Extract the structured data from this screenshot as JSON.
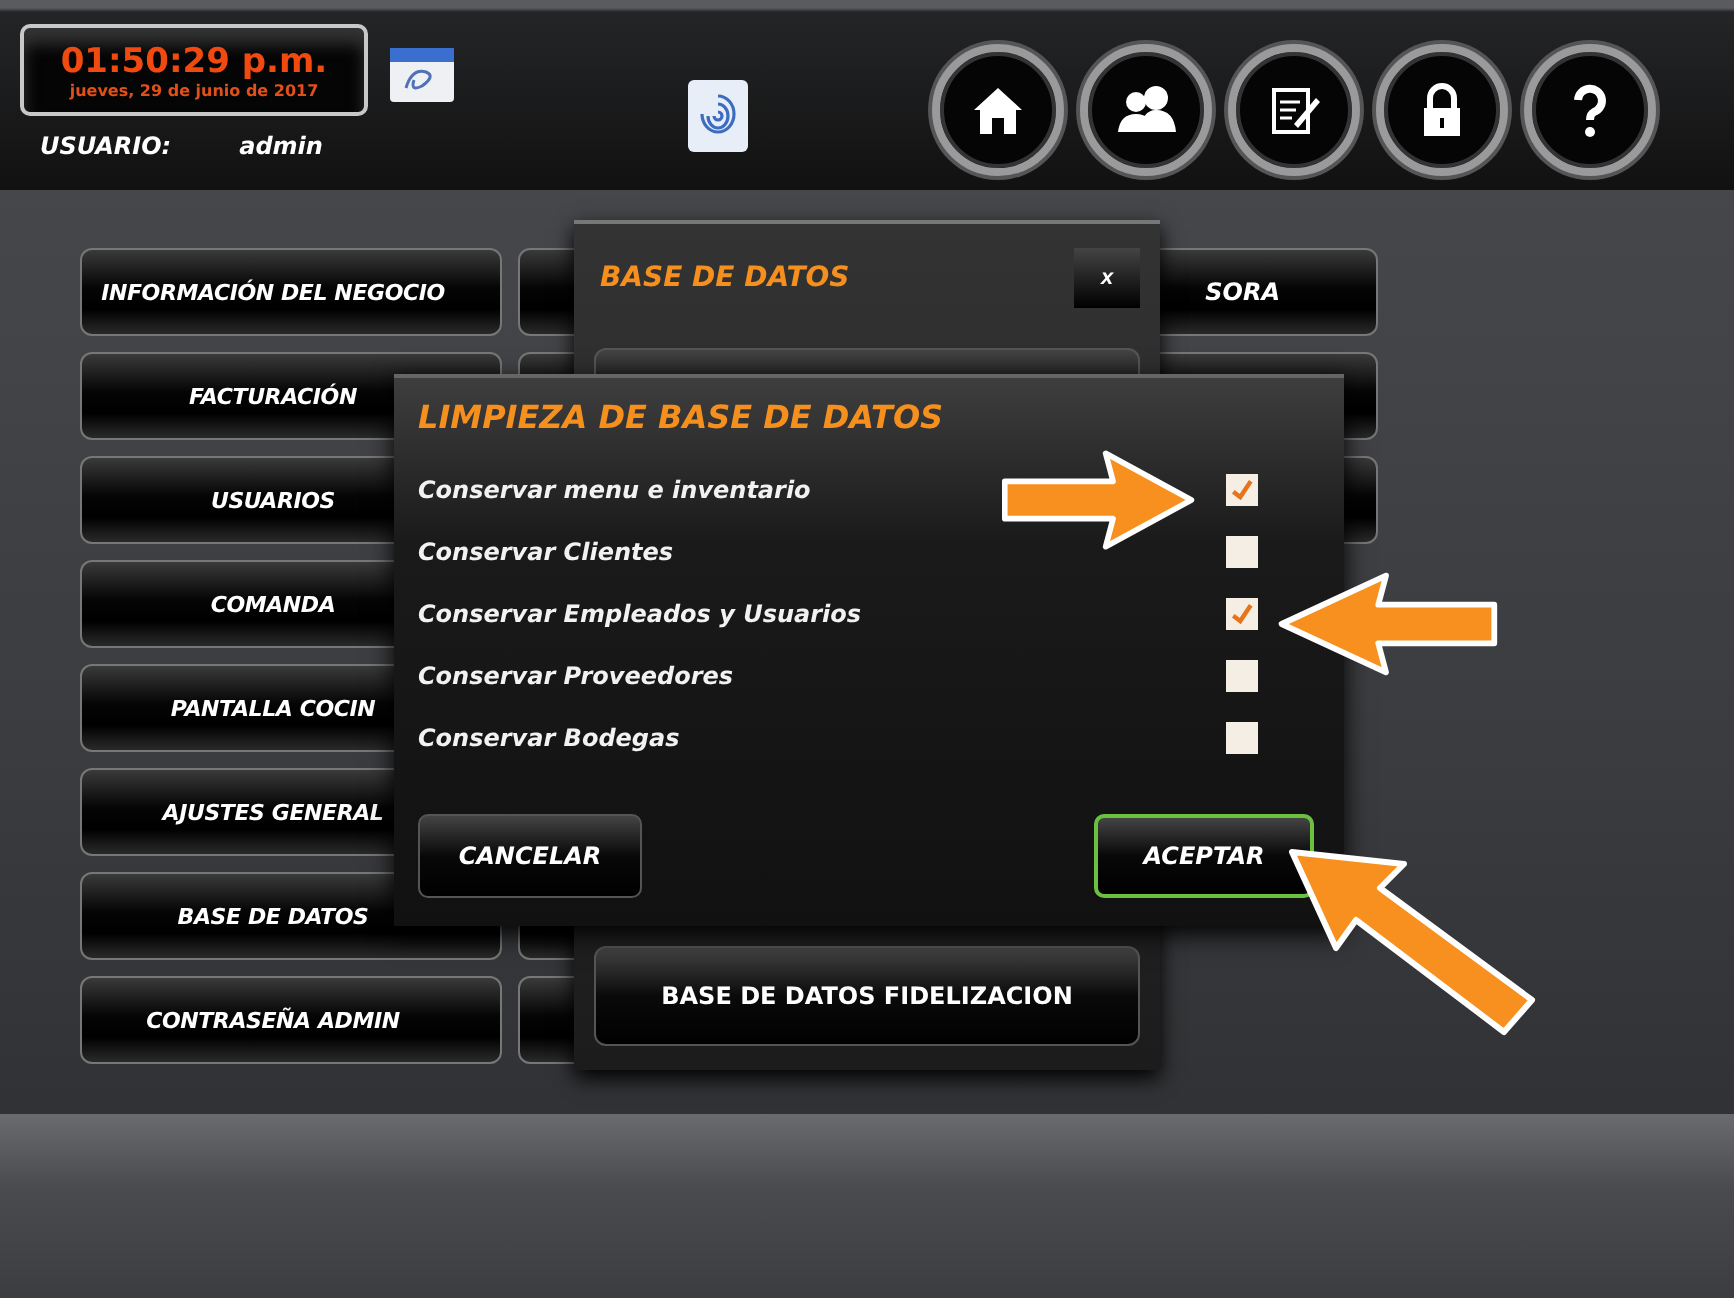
{
  "clock": {
    "time": "01:50:29 p.m.",
    "date": "jueves, 29 de junio de 2017"
  },
  "user": {
    "label": "USUARIO:",
    "name": "admin"
  },
  "nav_buttons": [
    {
      "kind": "home"
    },
    {
      "kind": "users"
    },
    {
      "kind": "notes"
    },
    {
      "kind": "lock"
    },
    {
      "kind": "help"
    }
  ],
  "menu": {
    "column_1": [
      "INFORMACIÓN DEL NEGOCIO",
      "FACTURACIÓN",
      "USUARIOS",
      "COMANDA",
      "PANTALLA COCIN",
      "AJUSTES GENERAL",
      "BASE DE DATOS",
      "CONTRASEÑA ADMIN"
    ],
    "column_3": [
      "SORA"
    ]
  },
  "database_dialog": {
    "title": "BASE DE DATOS",
    "close": "x",
    "buttons": [
      "BASE DE DATOS FIDELIZACION"
    ]
  },
  "cleanup_dialog": {
    "title": "LIMPIEZA DE BASE DE DATOS",
    "options": [
      {
        "label": "Conservar menu e inventario",
        "checked": true
      },
      {
        "label": "Conservar Clientes",
        "checked": false
      },
      {
        "label": "Conservar Empleados y Usuarios",
        "checked": true
      },
      {
        "label": "Conservar Proveedores",
        "checked": false
      },
      {
        "label": "Conservar Bodegas",
        "checked": false
      }
    ],
    "cancel": "CANCELAR",
    "accept": "ACEPTAR"
  }
}
